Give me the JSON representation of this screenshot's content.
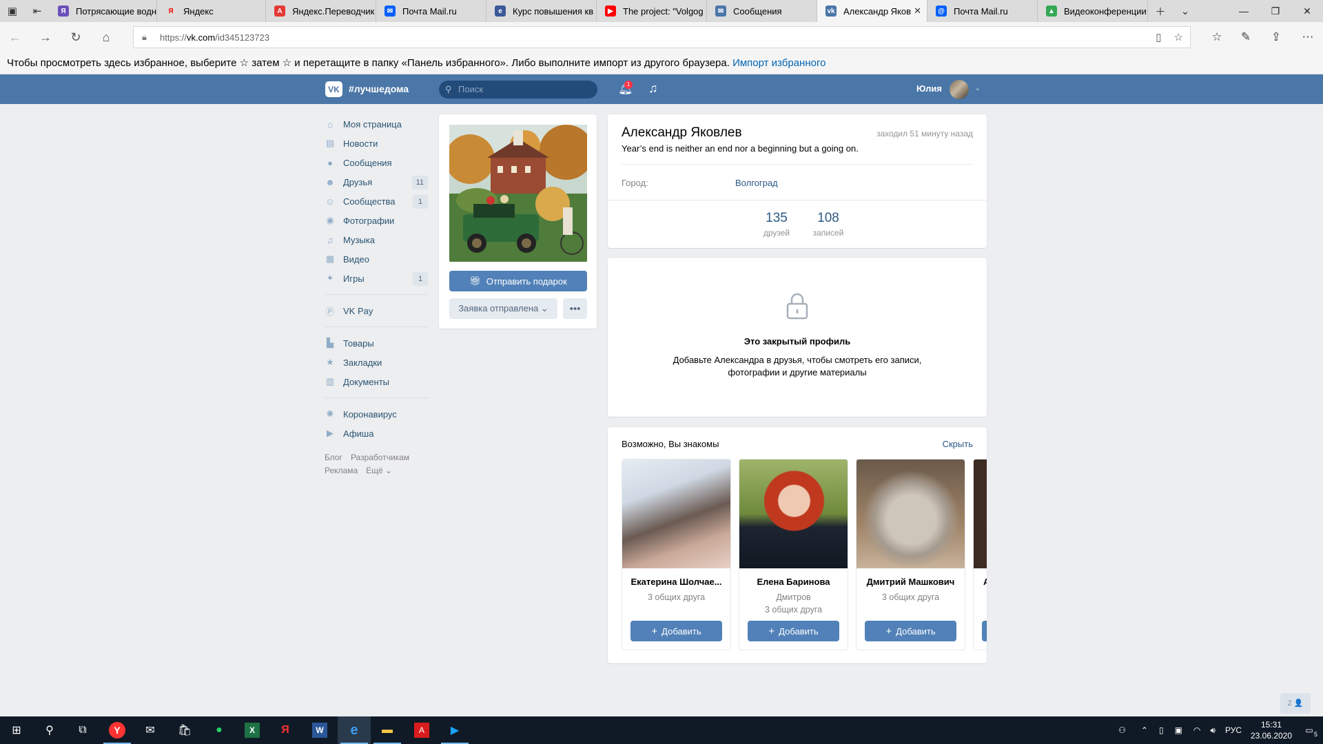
{
  "browser": {
    "tabs": [
      {
        "label": "Потрясающие водн",
        "fav": "yandex-zen",
        "color": "#6b4fbb"
      },
      {
        "label": "Яндекс",
        "fav": "Я",
        "color": "#ff0000"
      },
      {
        "label": "Яндекс.Переводчик",
        "fav": "translate",
        "color": "#e53935"
      },
      {
        "label": "Почта Mail.ru",
        "fav": "mail",
        "color": "#005ff9"
      },
      {
        "label": "Курс повышения кв",
        "fav": "course",
        "color": "#3b5998"
      },
      {
        "label": "The project: \"Volgog",
        "fav": "youtube",
        "color": "#ff0000"
      },
      {
        "label": "Сообщения",
        "fav": "messages",
        "color": "#4a76a8"
      },
      {
        "label": "Александр Яков",
        "fav": "vk",
        "color": "#4a76a8"
      },
      {
        "label": "Почта Mail.ru",
        "fav": "mail",
        "color": "#005ff9"
      },
      {
        "label": "Видеоконференции",
        "fav": "drive",
        "color": "#34a853"
      }
    ],
    "url_prefix": "https://",
    "url_host": "vk.com",
    "url_path": "/id345123723",
    "favorites_bar_text": "Чтобы просмотреть здесь избранное, выберите ☆ затем ☆ и перетащите в папку «Панель избранного». Либо выполните импорт из другого браузера.",
    "favorites_import_link": "Импорт избранного"
  },
  "header": {
    "logo": "VK",
    "hashtag": "#лучшедома",
    "search_placeholder": "Поиск",
    "notifications_count": "1",
    "user_name": "Юлия"
  },
  "menu": {
    "items": [
      {
        "label": "Моя страница",
        "icon": "home-icon",
        "glyph": "⌂",
        "count": ""
      },
      {
        "label": "Новости",
        "icon": "news-icon",
        "glyph": "▤",
        "count": ""
      },
      {
        "label": "Сообщения",
        "icon": "messages-icon",
        "glyph": "●",
        "count": ""
      },
      {
        "label": "Друзья",
        "icon": "friends-icon",
        "glyph": "☻",
        "count": "11"
      },
      {
        "label": "Сообщества",
        "icon": "communities-icon",
        "glyph": "☺",
        "count": "1"
      },
      {
        "label": "Фотографии",
        "icon": "photos-icon",
        "glyph": "◉",
        "count": ""
      },
      {
        "label": "Музыка",
        "icon": "music-icon",
        "glyph": "♫",
        "count": ""
      },
      {
        "label": "Видео",
        "icon": "video-icon",
        "glyph": "▦",
        "count": ""
      },
      {
        "label": "Игры",
        "icon": "games-icon",
        "glyph": "✦",
        "count": "1"
      }
    ],
    "pay": {
      "label": "VK Pay",
      "icon": "vkpay-icon",
      "glyph": "Ⓟ"
    },
    "items2": [
      {
        "label": "Товары",
        "icon": "goods-icon",
        "glyph": "▙"
      },
      {
        "label": "Закладки",
        "icon": "bookmarks-icon",
        "glyph": "★"
      },
      {
        "label": "Документы",
        "icon": "documents-icon",
        "glyph": "▥"
      }
    ],
    "items3": [
      {
        "label": "Коронавирус",
        "icon": "coronavirus-icon",
        "glyph": "✺"
      },
      {
        "label": "Афиша",
        "icon": "afisha-icon",
        "glyph": "▶"
      }
    ],
    "footer": [
      "Блог",
      "Разработчикам",
      "Реклама",
      "Ещё ⌄"
    ]
  },
  "profile": {
    "gift_button": "Отправить подарок",
    "request_button": "Заявка отправлена ⌄",
    "more_button": "•••",
    "name": "Александр Яковлев",
    "status": "Year’s end is neither an end nor a beginning but a going on.",
    "last_seen": "заходил 51 минуту назад",
    "city_label": "Город:",
    "city_value": "Волгоград",
    "stats": [
      {
        "n": "135",
        "label": "друзей"
      },
      {
        "n": "108",
        "label": "записей"
      }
    ]
  },
  "private": {
    "title": "Это закрытый профиль",
    "text": "Добавьте Александра в друзья, чтобы смотреть его записи, фотографии и другие материалы"
  },
  "suggestions": {
    "title": "Возможно, Вы знакомы",
    "hide": "Скрыть",
    "add_label": "Добавить",
    "people": [
      {
        "name": "Екатерина Шолчае...",
        "sub1": "3 общих друга",
        "sub2": ""
      },
      {
        "name": "Елена Баринова",
        "sub1": "Дмитров",
        "sub2": "3 общих друга"
      },
      {
        "name": "Дмитрий Машкович",
        "sub1": "3 общих друга",
        "sub2": ""
      },
      {
        "name": "А",
        "sub1": "",
        "sub2": ""
      }
    ]
  },
  "chat_widget": "2 👤",
  "taskbar": {
    "lang": "РУС",
    "time": "15:31",
    "date": "23.06.2020",
    "notif_count": "5"
  }
}
